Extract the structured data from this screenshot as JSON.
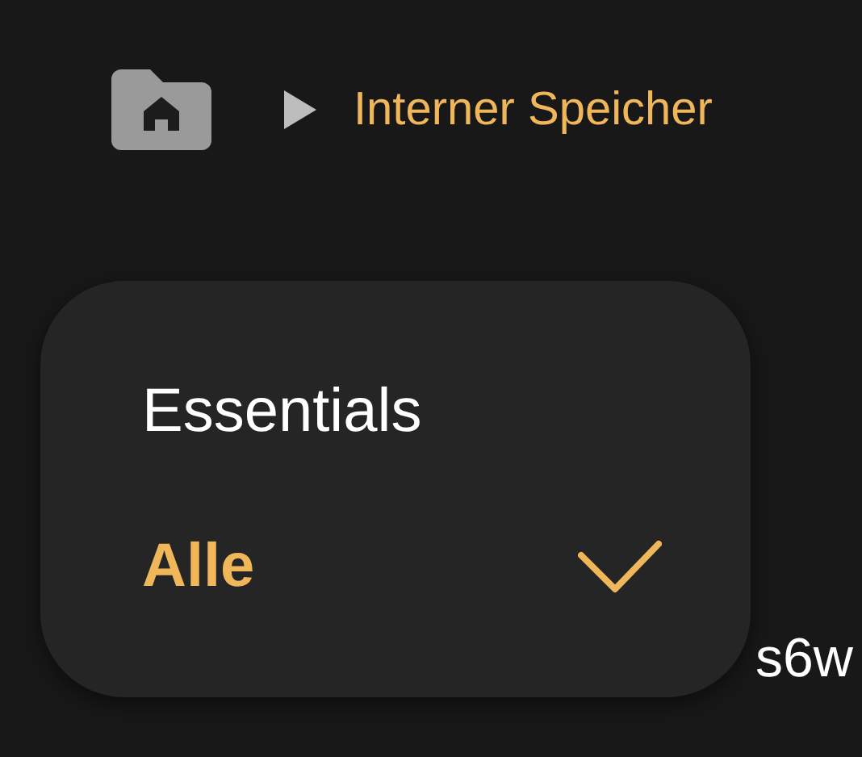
{
  "breadcrumb": {
    "location": "Interner Speicher"
  },
  "list_item": {
    "text": "s6w"
  },
  "menu": {
    "items": [
      {
        "label": "Essentials",
        "selected": false
      },
      {
        "label": "Alle",
        "selected": true
      }
    ]
  }
}
